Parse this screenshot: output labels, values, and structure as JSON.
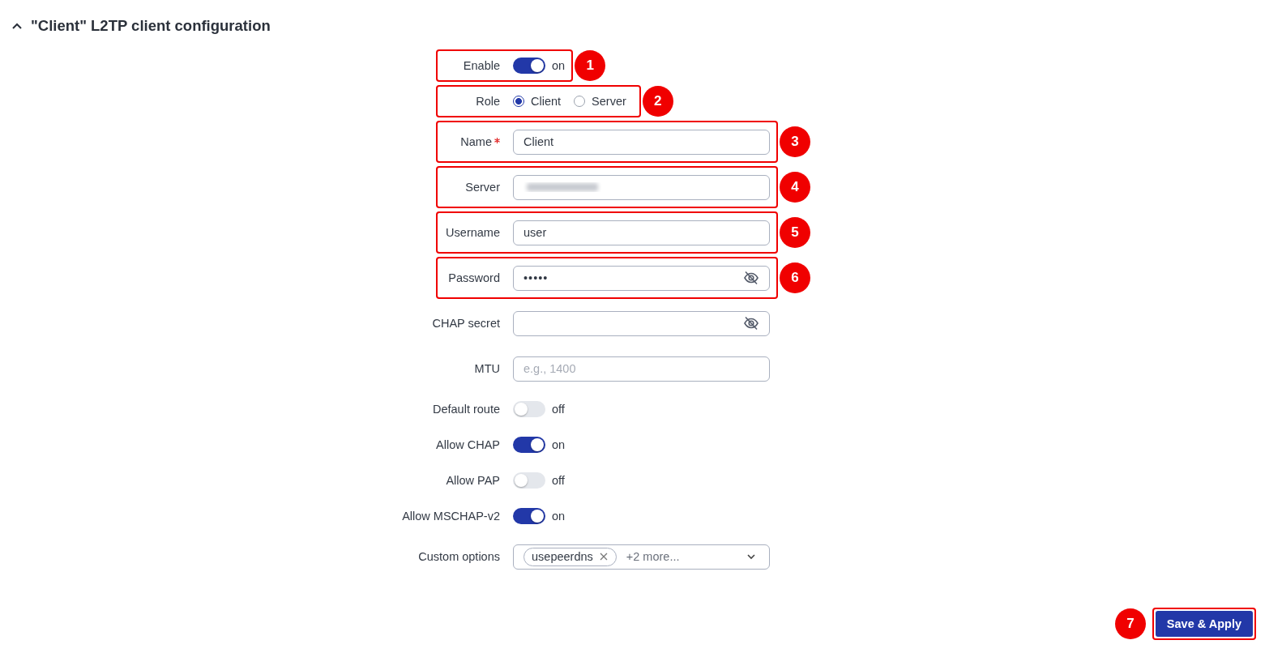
{
  "section": {
    "title": "\"Client\" L2TP client configuration",
    "expanded": true
  },
  "fields": [
    {
      "kind": "toggle",
      "label": "Enable",
      "on": true,
      "state_text": "on",
      "marker": "1"
    },
    {
      "kind": "radio",
      "label": "Role",
      "marker": "2",
      "options": [
        {
          "label": "Client",
          "selected": true
        },
        {
          "label": "Server",
          "selected": false
        }
      ]
    },
    {
      "kind": "input",
      "label": "Name",
      "required": true,
      "value": "Client",
      "marker": "3"
    },
    {
      "kind": "redacted",
      "label": "Server",
      "marker": "4"
    },
    {
      "kind": "input",
      "label": "Username",
      "required": false,
      "value": "user",
      "marker": "5"
    },
    {
      "kind": "password",
      "label": "Password",
      "value": "•••••",
      "marker": "6"
    },
    {
      "kind": "password",
      "label": "CHAP secret"
    },
    {
      "kind": "input",
      "label": "MTU",
      "required": false,
      "placeholder": "e.g., 1400"
    },
    {
      "kind": "toggle",
      "label": "Default route",
      "on": false,
      "state_text": "off"
    },
    {
      "kind": "toggle",
      "label": "Allow CHAP",
      "on": true,
      "state_text": "on"
    },
    {
      "kind": "toggle",
      "label": "Allow PAP",
      "on": false,
      "state_text": "off"
    },
    {
      "kind": "toggle",
      "label": "Allow MSCHAP-v2",
      "on": true,
      "state_text": "on"
    },
    {
      "kind": "multiselect",
      "label": "Custom options",
      "tags": [
        "usepeerdns"
      ],
      "more": "+2 more..."
    }
  ],
  "save_button": {
    "label": "Save & Apply",
    "marker": "7"
  }
}
